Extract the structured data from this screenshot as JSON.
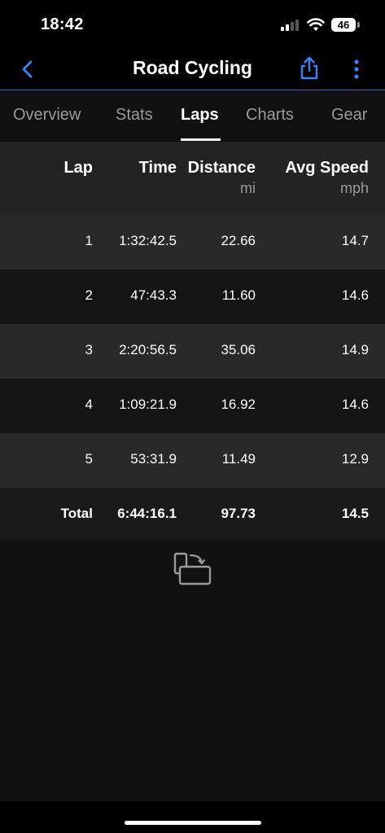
{
  "status_bar": {
    "time": "18:42",
    "battery": "46"
  },
  "nav": {
    "title": "Road Cycling"
  },
  "tabs": [
    {
      "label": "Overview",
      "active": false
    },
    {
      "label": "Stats",
      "active": false
    },
    {
      "label": "Laps",
      "active": true
    },
    {
      "label": "Charts",
      "active": false
    },
    {
      "label": "Gear",
      "active": false
    }
  ],
  "table": {
    "headers": {
      "lap": "Lap",
      "time": "Time",
      "distance": "Distance",
      "distance_unit": "mi",
      "avg_speed": "Avg Speed",
      "avg_speed_unit": "mph"
    },
    "rows": [
      {
        "lap": "1",
        "time": "1:32:42.5",
        "distance": "22.66",
        "avg_speed": "14.7"
      },
      {
        "lap": "2",
        "time": "47:43.3",
        "distance": "11.60",
        "avg_speed": "14.6"
      },
      {
        "lap": "3",
        "time": "2:20:56.5",
        "distance": "35.06",
        "avg_speed": "14.9"
      },
      {
        "lap": "4",
        "time": "1:09:21.9",
        "distance": "16.92",
        "avg_speed": "14.6"
      },
      {
        "lap": "5",
        "time": "53:31.9",
        "distance": "11.49",
        "avg_speed": "12.9"
      }
    ],
    "total": {
      "lap": "Total",
      "time": "6:44:16.1",
      "distance": "97.73",
      "avg_speed": "14.5"
    }
  },
  "colors": {
    "accent": "#2f6fd6",
    "background": "#000000",
    "row_odd": "#292929",
    "row_even": "#141414"
  },
  "icons": {
    "back": "chevron-left-icon",
    "share": "share-icon",
    "more": "more-vertical-icon",
    "rotate": "rotate-device-icon"
  }
}
